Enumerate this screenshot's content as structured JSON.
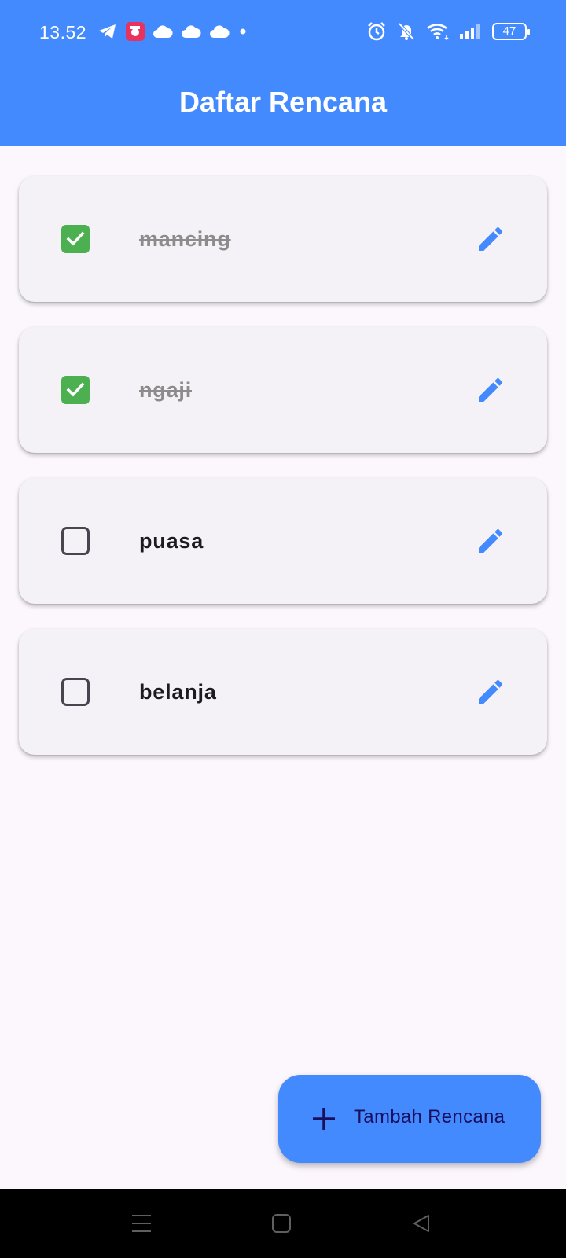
{
  "status_bar": {
    "time": "13.52",
    "battery": "47",
    "left_icons": [
      "telegram-icon",
      "app-notification-icon",
      "cloud-icon",
      "cloud-icon",
      "cloud-icon",
      "dot-icon"
    ],
    "right_icons": [
      "alarm-icon",
      "bell-muted-icon",
      "wifi-icon",
      "signal-icon",
      "battery-icon"
    ]
  },
  "app_bar": {
    "title": "Daftar Rencana"
  },
  "colors": {
    "primary": "#448aff",
    "checked": "#4caf50",
    "background": "#fcf7fd",
    "card": "#f4f1f7",
    "fab_text": "#1a0f5e"
  },
  "plans": [
    {
      "label": "mancing",
      "done": true
    },
    {
      "label": "ngaji",
      "done": true
    },
    {
      "label": "puasa",
      "done": false
    },
    {
      "label": "belanja",
      "done": false
    }
  ],
  "fab": {
    "label": "Tambah Rencana",
    "icon": "plus-icon"
  },
  "nav_bar": {
    "buttons": [
      "menu-icon",
      "home-icon",
      "back-icon"
    ]
  }
}
